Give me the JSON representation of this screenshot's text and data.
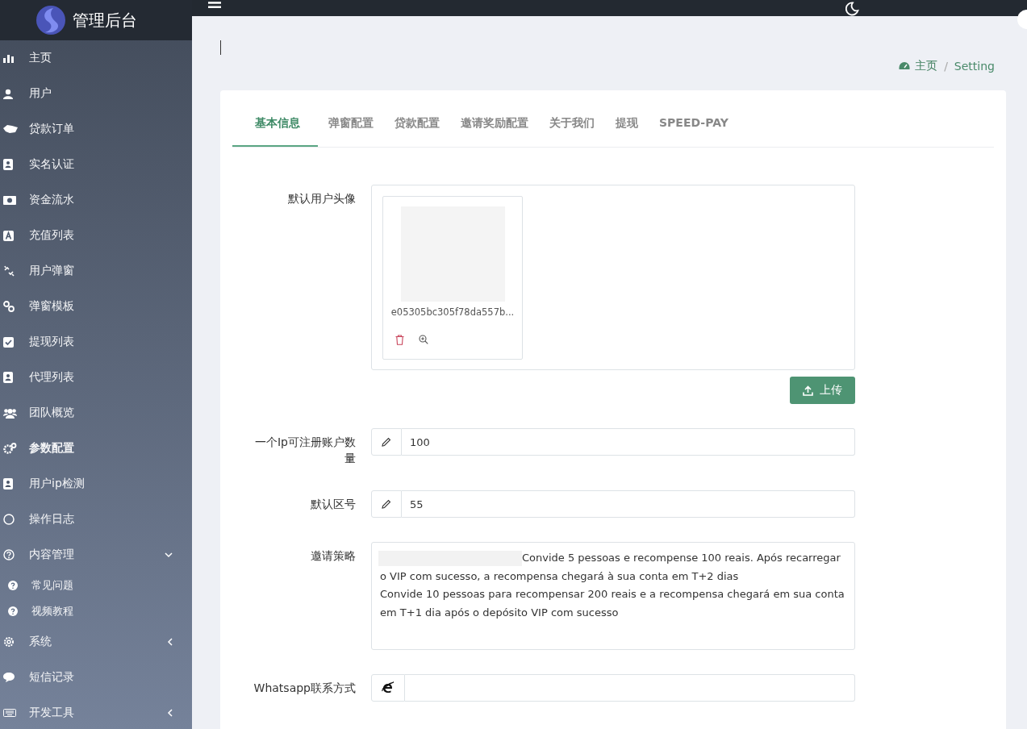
{
  "brand": {
    "title": "管理后台"
  },
  "sidebar": {
    "items": [
      {
        "label": "主页",
        "active": false
      },
      {
        "label": "用户",
        "active": false
      },
      {
        "label": "贷款订单",
        "active": false
      },
      {
        "label": "实名认证",
        "active": false
      },
      {
        "label": "资金流水",
        "active": false
      },
      {
        "label": "充值列表",
        "active": false
      },
      {
        "label": "用户弹窗",
        "active": false
      },
      {
        "label": "弹窗模板",
        "active": false
      },
      {
        "label": "提现列表",
        "active": false
      },
      {
        "label": "代理列表",
        "active": false
      },
      {
        "label": "团队概览",
        "active": false
      },
      {
        "label": "参数配置",
        "active": true
      },
      {
        "label": "用户ip检测",
        "active": false
      },
      {
        "label": "操作日志",
        "active": false
      },
      {
        "label": "内容管理",
        "active": false,
        "expanded": true,
        "children": [
          {
            "label": "常见问题",
            "active": false
          },
          {
            "label": "视频教程",
            "active": false
          }
        ]
      },
      {
        "label": "系统",
        "active": false,
        "expanded": false
      },
      {
        "label": "短信记录",
        "active": false
      },
      {
        "label": "开发工具",
        "active": false,
        "expanded": false
      }
    ]
  },
  "breadcrumb": {
    "items": [
      {
        "label": "主页"
      },
      {
        "label": "Setting"
      }
    ],
    "separator": "/"
  },
  "tabs": [
    {
      "label": "基本信息",
      "selected": true
    },
    {
      "label": "弹窗配置",
      "selected": false
    },
    {
      "label": "贷款配置",
      "selected": false
    },
    {
      "label": "邀请奖励配置",
      "selected": false
    },
    {
      "label": "关于我们",
      "selected": false
    },
    {
      "label": "提现",
      "selected": false
    },
    {
      "label": "SPEED-PAY",
      "selected": false
    }
  ],
  "form": [
    {
      "kind": "upload",
      "label": "默认用户头像",
      "file_name": "e05305bc305f78da557b...",
      "button": "上传"
    },
    {
      "kind": "text_input",
      "label": "一个Ip可注册账户数量",
      "value": "100"
    },
    {
      "kind": "text_input",
      "label": "默认区号",
      "value": "55"
    },
    {
      "kind": "textarea",
      "label": "邀请策略",
      "value": "Convide 5 pessoas e recompense 100 reais. Após recarregar o VIP com sucesso, a recompensa chegará à sua conta em T+2 dias\nConvide 10 pessoas para recompensar 200 reais e a recompensa chegará em sua conta em T+1 dia após o depósito VIP com sucesso"
    },
    {
      "kind": "contact_input",
      "label": "Whatsapp联系方式"
    }
  ]
}
